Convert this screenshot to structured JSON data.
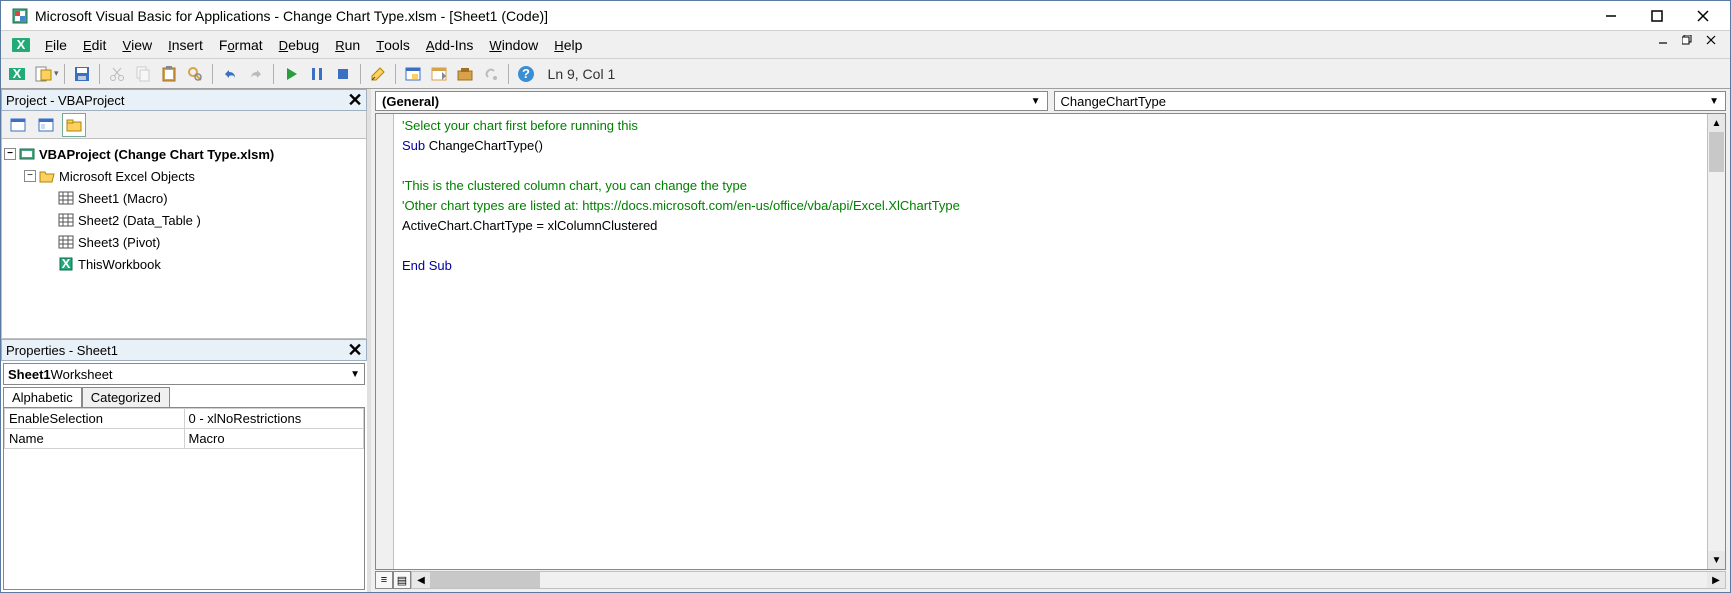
{
  "titlebar": {
    "title": "Microsoft Visual Basic for Applications - Change Chart Type.xlsm - [Sheet1 (Code)]"
  },
  "menu": {
    "file": "File",
    "edit": "Edit",
    "view": "View",
    "insert": "Insert",
    "format": "Format",
    "debug": "Debug",
    "run": "Run",
    "tools": "Tools",
    "addins": "Add-Ins",
    "window": "Window",
    "help": "Help"
  },
  "toolbar": {
    "status": "Ln 9, Col 1"
  },
  "project": {
    "title": "Project - VBAProject",
    "root": "VBAProject (Change Chart Type.xlsm)",
    "folder": "Microsoft Excel Objects",
    "items": [
      "Sheet1 (Macro)",
      "Sheet2 (Data_Table )",
      "Sheet3 (Pivot)",
      "ThisWorkbook"
    ]
  },
  "properties": {
    "title": "Properties - Sheet1",
    "combo_bold": "Sheet1",
    "combo_rest": " Worksheet",
    "tab_alpha": "Alphabetic",
    "tab_cat": "Categorized",
    "rows": [
      {
        "k": "EnableSelection",
        "v": "0 - xlNoRestrictions"
      },
      {
        "k": "Name",
        "v": "Macro"
      }
    ]
  },
  "code": {
    "combo_left": "(General)",
    "combo_right": "ChangeChartType",
    "lines": [
      {
        "t": "cm",
        "s": "'Select your chart first before running this"
      },
      {
        "t": "mix",
        "kw": "Sub ",
        "rest": "ChangeChartType()"
      },
      {
        "t": "",
        "s": ""
      },
      {
        "t": "cm",
        "s": "'This is the clustered column chart, you can change the type"
      },
      {
        "t": "cm",
        "s": "'Other chart types are listed at: https://docs.microsoft.com/en-us/office/vba/api/Excel.XlChartType"
      },
      {
        "t": "",
        "s": "ActiveChart.ChartType = xlColumnClustered"
      },
      {
        "t": "",
        "s": ""
      },
      {
        "t": "kw",
        "s": "End Sub"
      }
    ]
  }
}
